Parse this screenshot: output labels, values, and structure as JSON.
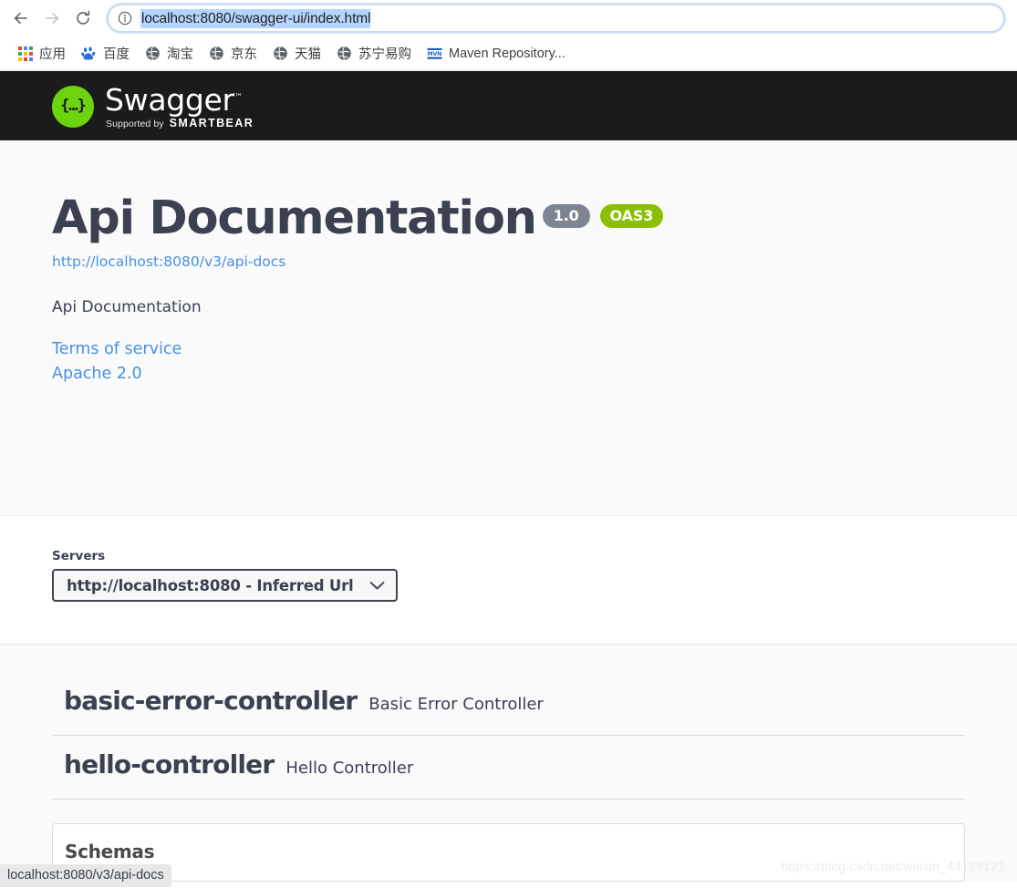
{
  "browser": {
    "back_tooltip": "Back",
    "forward_tooltip": "Forward",
    "reload_tooltip": "Reload",
    "site_info_tooltip": "View site information",
    "url": "localhost:8080/swagger-ui/index.html",
    "url_placeholder": "Search Google or type a URL",
    "bookmarks": [
      {
        "label": "应用",
        "icon": "apps-grid-icon"
      },
      {
        "label": "百度",
        "icon": "baidu-paw-icon"
      },
      {
        "label": "淘宝",
        "icon": "globe-icon"
      },
      {
        "label": "京东",
        "icon": "globe-icon"
      },
      {
        "label": "天猫",
        "icon": "globe-icon"
      },
      {
        "label": "苏宁易购",
        "icon": "globe-icon"
      },
      {
        "label": "Maven Repository...",
        "icon": "mvn-icon"
      }
    ],
    "status_bar": "localhost:8080/v3/api-docs"
  },
  "swagger": {
    "logo": {
      "glyph": "{…}",
      "word": "Swagger",
      "tm": "™",
      "supported_by": "Supported by",
      "brand": "SMARTBEAR"
    },
    "info": {
      "title": "Api Documentation",
      "version_badge": "1.0",
      "oas_badge": "OAS3",
      "api_docs_url": "http://localhost:8080/v3/api-docs",
      "description": "Api Documentation",
      "terms_of_service": "Terms of service",
      "license": "Apache 2.0"
    },
    "servers": {
      "label": "Servers",
      "selected": "http://localhost:8080 - Inferred Url",
      "options": [
        "http://localhost:8080 - Inferred Url"
      ]
    },
    "tags": [
      {
        "name": "basic-error-controller",
        "description": "Basic Error Controller"
      },
      {
        "name": "hello-controller",
        "description": "Hello Controller"
      }
    ],
    "schemas": {
      "title": "Schemas"
    }
  },
  "watermark": "https://blog.csdn.net/weixin_44129121",
  "colors": {
    "topbar_bg": "#1b1b1b",
    "logo_green": "#6cd40c",
    "oas_badge": "#89bf04",
    "version_badge": "#7d8492",
    "link_blue": "#4990e2",
    "text_dark": "#3b4151",
    "url_selection": "#b4d5fe"
  }
}
